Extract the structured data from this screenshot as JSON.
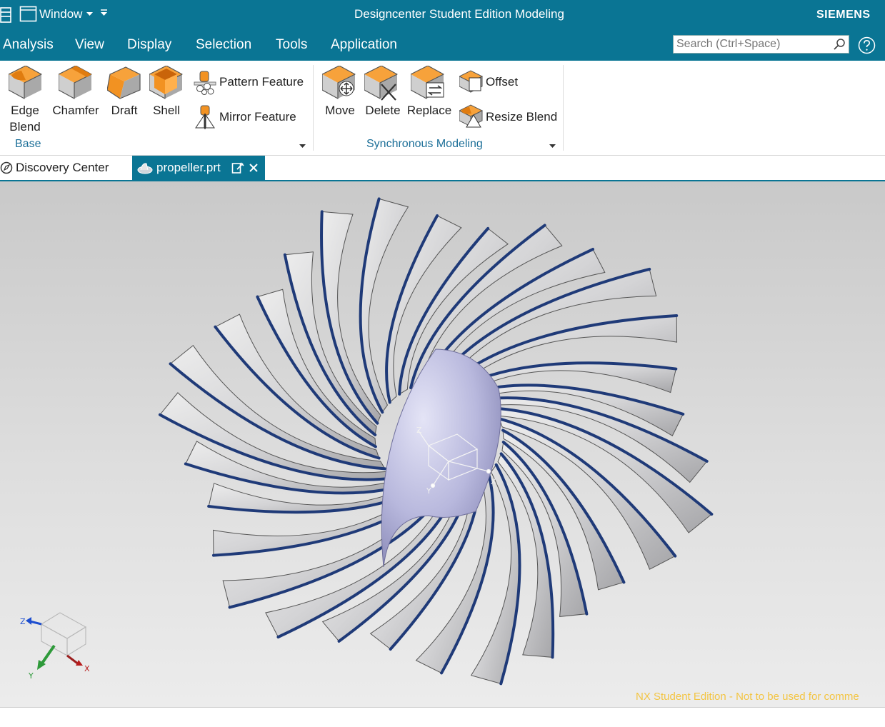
{
  "titlebar": {
    "window_label": "Window",
    "title": "Designcenter Student Edition Modeling",
    "brand": "SIEMENS"
  },
  "menubar": {
    "items": [
      "Analysis",
      "View",
      "Display",
      "Selection",
      "Tools",
      "Application"
    ],
    "search_placeholder": "Search (Ctrl+Space)"
  },
  "ribbon": {
    "base_group": {
      "label": "Base",
      "edge_blend_line1": "Edge",
      "edge_blend_line2": "Blend",
      "chamfer": "Chamfer",
      "draft": "Draft",
      "shell": "Shell",
      "pattern_feature": "Pattern Feature",
      "mirror_feature": "Mirror Feature"
    },
    "sync_group": {
      "label": "Synchronous Modeling",
      "move": "Move",
      "delete": "Delete",
      "replace": "Replace",
      "offset": "Offset",
      "resize_blend": "Resize Blend"
    }
  },
  "tabs": [
    {
      "label": "Discovery Center",
      "active": false
    },
    {
      "label": "propeller.prt",
      "active": true
    }
  ],
  "viewport": {
    "triad_z": "Z",
    "triad_y": "Y",
    "triad_x": "X",
    "watermark": "NX Student Edition - Not to be used for comme"
  },
  "colors": {
    "accent": "#0a7594",
    "icon_orange": "#f29222",
    "blade_edge": "#1f3a78",
    "hub": "#b8b8dd",
    "watermark": "#f3c544"
  }
}
